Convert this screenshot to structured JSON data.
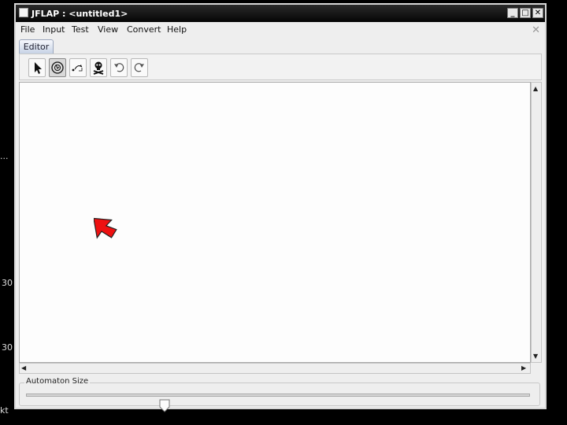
{
  "background": {
    "left_marks": [
      "...",
      "30",
      "30",
      "kt"
    ]
  },
  "window": {
    "title": "JFLAP : <untitled1>",
    "controls": {
      "minimize": "_",
      "maximize": "□",
      "close": "✕"
    }
  },
  "menu": {
    "items": [
      "File",
      "Input",
      "Test",
      "View",
      "Convert",
      "Help"
    ],
    "close_glyph": "✕"
  },
  "tabs": [
    {
      "label": "Editor",
      "selected": true
    }
  ],
  "toolbar": {
    "tools": [
      {
        "name": "attribute-editor",
        "icon": "pointer-arrow-icon",
        "selected": false
      },
      {
        "name": "state-creator",
        "icon": "state-circle-icon",
        "selected": true
      },
      {
        "name": "transition-creator",
        "icon": "transition-arrow-icon",
        "selected": false
      },
      {
        "name": "deleter",
        "icon": "skull-icon",
        "selected": false
      },
      {
        "name": "undo",
        "icon": "undo-icon",
        "selected": false
      },
      {
        "name": "redo",
        "icon": "redo-icon",
        "selected": false
      }
    ]
  },
  "automaton_size": {
    "label": "Automaton Size",
    "level": 0.27
  },
  "colors": {
    "cursor": "#ee1111",
    "titlebar": "#111111",
    "tab": "#c7d3e6"
  }
}
